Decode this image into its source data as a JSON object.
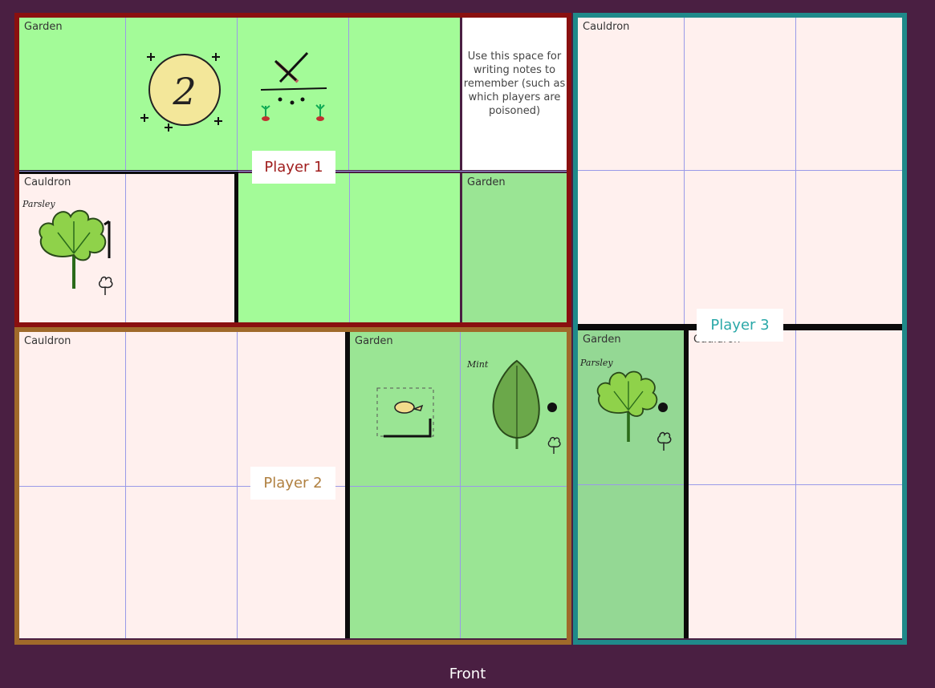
{
  "labels": {
    "garden": "Garden",
    "cauldron": "Cauldron"
  },
  "players": {
    "p1": "Player 1",
    "p2": "Player 2",
    "p3": "Player 3"
  },
  "notes": "Use this space for writing notes to remember (such as which players are poisoned)",
  "round_number": "2",
  "cards": {
    "parsley": "Parsley",
    "mint": "Mint"
  },
  "footer": "Front",
  "colors": {
    "background": "#4a1f42",
    "player1": "#8a1010",
    "player2": "#a06a2a",
    "player3": "#1f8a8a",
    "garden_light": "#a3fb98",
    "garden_mid": "#9ae594",
    "cauldron": "#fff0ee"
  },
  "icons": [
    "sun-token-icon",
    "crossed-out-seeds-icon",
    "parsley-leaf-icon",
    "mint-leaf-icon",
    "plant-outline-icon",
    "dashed-sprout-icon"
  ]
}
